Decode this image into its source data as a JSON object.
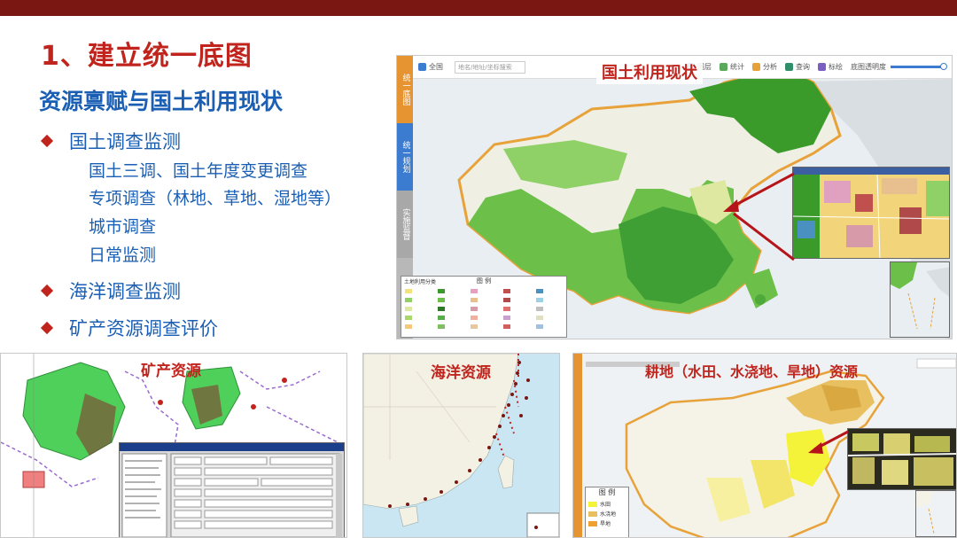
{
  "slide": {
    "title": "1、建立统一底图",
    "subtitle": "资源禀赋与国土利用现状",
    "bullets": [
      {
        "label": "国土调查监测",
        "subs": [
          "国土三调、国土年度变更调查",
          "专项调查（林地、草地、湿地等）",
          "城市调查",
          "日常监测"
        ]
      },
      {
        "label": "海洋调查监测",
        "subs": []
      },
      {
        "label": "矿产资源调查评价",
        "subs": []
      }
    ]
  },
  "panels": {
    "land_use": {
      "title": "国土利用现状",
      "tabs": [
        "统一底图",
        "统一规划",
        "实施监督"
      ],
      "toolbar": {
        "region": "全国",
        "search_placeholder": "地名/地址/坐标搜索",
        "items": [
          "图层",
          "统计",
          "分析",
          "查询",
          "标绘"
        ],
        "opacity_label": "底图透明度"
      },
      "legend_title": "图 例",
      "legend_heading": "土地利用分类"
    },
    "mineral": {
      "title": "矿产资源"
    },
    "ocean": {
      "title": "海洋资源"
    },
    "farmland": {
      "title": "耕地（水田、水浇地、旱地）资源",
      "legend_title": "图 例",
      "legend_items": [
        "水田",
        "水浇地",
        "旱地"
      ]
    }
  },
  "colors": {
    "title_red": "#c0241d",
    "subtitle_blue": "#1a5fb4",
    "top_bar": "#7a1712",
    "arrow": "#b5151a",
    "forest_green": "#3a9a2a",
    "grass_green": "#6cc04a",
    "desert": "#efefe4",
    "china_border": "#e8a23a",
    "tab_orange": "#e69432",
    "tab_blue": "#3b7bd0",
    "tab_gray": "#a8a8a8"
  }
}
